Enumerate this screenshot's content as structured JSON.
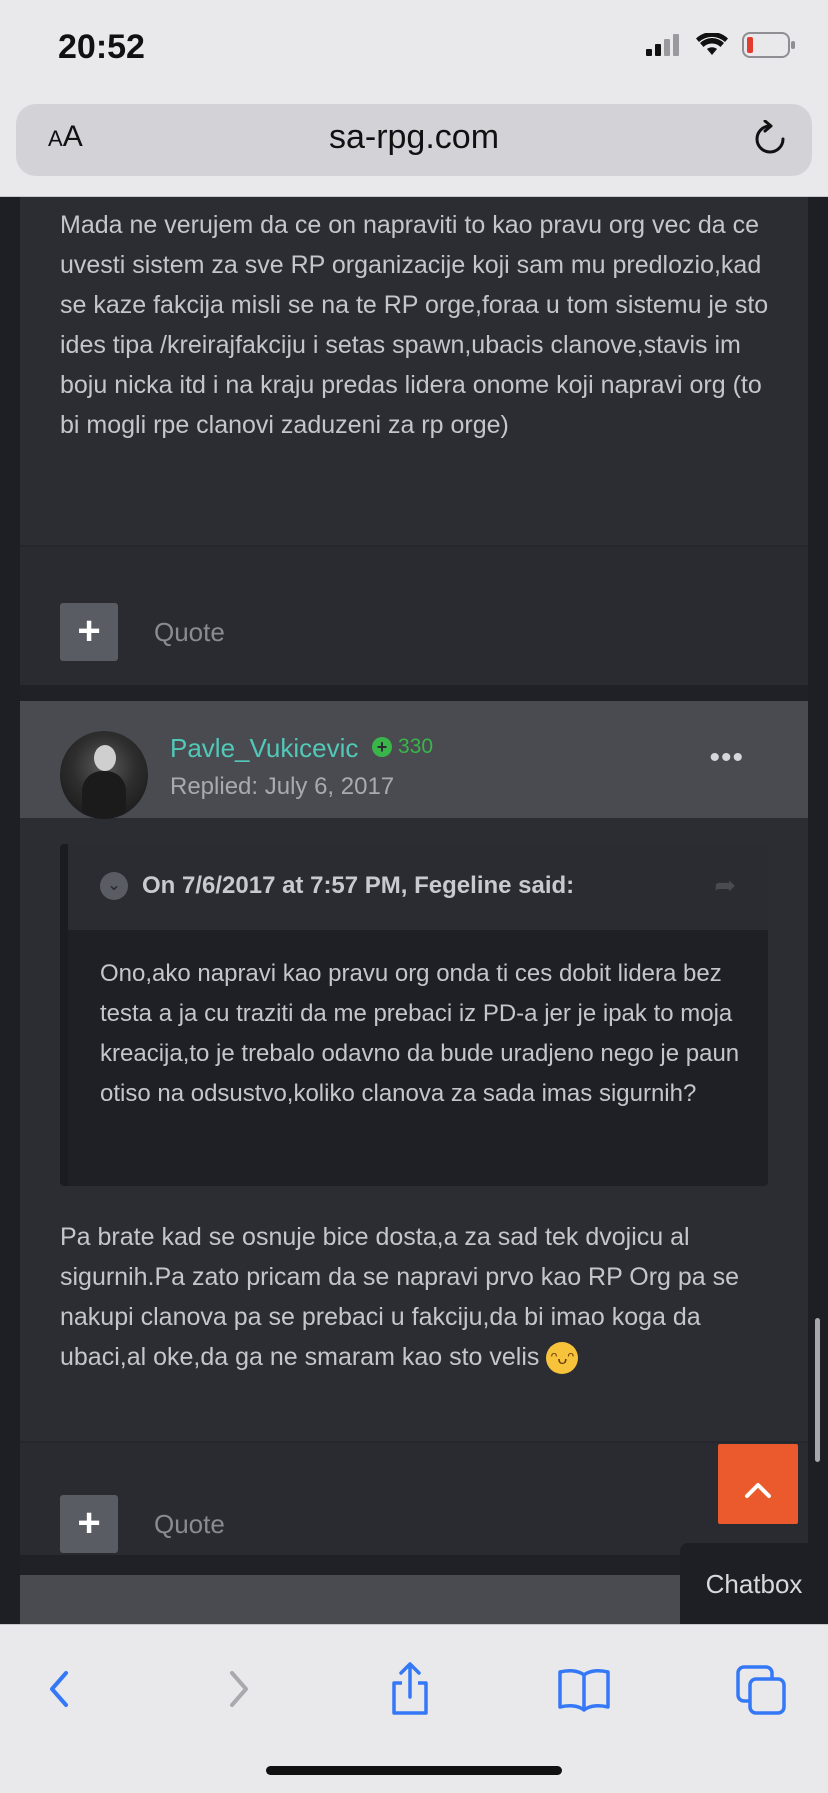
{
  "status_bar": {
    "time": "20:52"
  },
  "browser": {
    "text_size_label_small": "A",
    "text_size_label_big": "A",
    "url": "sa-rpg.com"
  },
  "post1": {
    "body": "Mada ne verujem da ce on napraviti to kao pravu org vec da ce uvesti sistem za sve RP organizacije koji sam mu predlozio,kad se kaze fakcija misli se na te RP orge,foraa u tom sistemu je sto ides tipa /kreirajfakciju i setas spawn,ubacis clanove,stavis im boju nicka itd i na kraju predas lidera onome koji napravi org (to bi mogli rpe clanovi zaduzeni za rp orge)",
    "plus_label": "+",
    "quote_label": "Quote"
  },
  "post2": {
    "username": "Pavle_Vukicevic",
    "reputation": "330",
    "replied": "Replied: July 6, 2017",
    "more_label": "•••",
    "quote_citation": "On 7/6/2017 at 7:57 PM, Fegeline said:",
    "quote_body": "Ono,ako napravi kao pravu org onda ti ces dobit lidera bez testa a ja cu traziti da me prebaci iz PD-a jer je ipak to moja kreacija,to je trebalo odavno da bude uradjeno nego je paun otiso na odsustvo,koliko clanova za sada imas sigurnih?",
    "body": "Pa brate kad se osnuje bice dosta,a za sad tek dvojicu al sigurnih.Pa zato pricam da se napravi prvo kao RP Org pa se nakupi clanova pa se prebaci u fakciju,da bi imao koga da ubaci,al oke,da ga ne smaram kao sto velis",
    "plus_label": "+",
    "quote_label": "Quote"
  },
  "widgets": {
    "chatbox_label": "Chatbox"
  },
  "colors": {
    "accent_teal": "#52c8b8",
    "reputation_green": "#39b54a",
    "back_to_top": "#ea5a2c",
    "ios_blue": "#3478f6"
  }
}
